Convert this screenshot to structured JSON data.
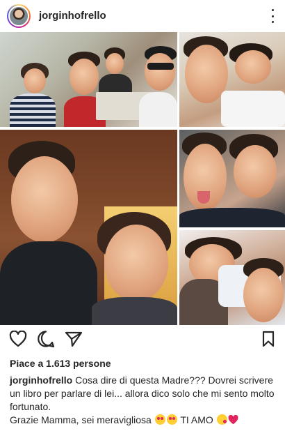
{
  "post": {
    "username": "jorginhofrello",
    "likes_text": "Piace a 1.613 persone",
    "caption_user": "jorginhofrello",
    "caption_text": "Cosa dire di questa Madre??? Dovrei scrivere un libro per parlare di lei... allora dico solo che mi sento molto fortunato.",
    "caption_line2": "Grazie Mamma, sei meravigliosa",
    "caption_ti_amo": "TI AMO"
  },
  "icons": {
    "more": "more-vertical-icon",
    "like": "heart-icon",
    "comment": "comment-icon",
    "share": "send-icon",
    "save": "bookmark-icon"
  },
  "colors": {
    "text": "#262626",
    "heart": "#e0245e",
    "emoji": "#ffcf33"
  }
}
